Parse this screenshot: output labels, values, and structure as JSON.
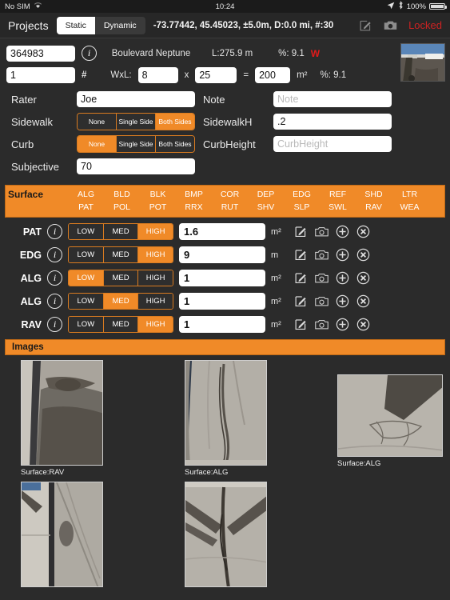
{
  "statusbar": {
    "carrier": "No SIM",
    "wifi_icon": "wifi-icon",
    "time": "10:24",
    "location_icon": "location-arrow-icon",
    "bluetooth_icon": "bluetooth-icon",
    "battery_percent": "100%",
    "battery_icon": "battery-full-icon"
  },
  "toolbar": {
    "projects_label": "Projects",
    "mode_static": "Static",
    "mode_dynamic": "Dynamic",
    "mode_selected": "Static",
    "coordinates": "-73.77442, 45.45023, ±5.0m, D:0.0 mi, #:30",
    "edit_icon": "edit-pencil-icon",
    "camera_icon": "camera-icon",
    "lock_status": "Locked",
    "lock_color": "#cc2222"
  },
  "header": {
    "segment_id": "364983",
    "info_icon": "info-circle-icon",
    "street_name": "Boulevard Neptune",
    "length_label": "L:275.9 m",
    "percent_label": "%: 9.1",
    "warning_flag": "W",
    "section_number": "1",
    "hash_symbol": "#",
    "wxl_label": "WxL:",
    "width": "8",
    "times_symbol": "x",
    "length": "25",
    "equals_symbol": "=",
    "area": "200",
    "area_unit": "m²",
    "percent_label2": "%: 9.1",
    "thumbnail_name": "road-scene-thumbnail"
  },
  "form": {
    "rater_label": "Rater",
    "rater_value": "Joe",
    "note_label": "Note",
    "note_value": "",
    "note_placeholder": "Note",
    "sidewalk_label": "Sidewalk",
    "sidewalk_options": [
      "None",
      "Single Side",
      "Both Sides"
    ],
    "sidewalk_selected": "Both Sides",
    "sidewalkh_label": "SidewalkH",
    "sidewalkh_value": ".2",
    "curb_label": "Curb",
    "curb_options": [
      "None",
      "Single Side",
      "Both Sides"
    ],
    "curb_selected": "None",
    "curbheight_label": "CurbHeight",
    "curbheight_value": "",
    "curbheight_placeholder": "CurbHeight",
    "subjective_label": "Subjective",
    "subjective_value": "70"
  },
  "surface": {
    "panel_title": "Surface",
    "accent_color": "#f08a28",
    "codes_row1": [
      "ALG",
      "BLD",
      "BLK",
      "BMP",
      "COR",
      "DEP",
      "EDG",
      "REF",
      "SHD",
      "LTR"
    ],
    "codes_row2": [
      "PAT",
      "POL",
      "POT",
      "RRX",
      "RUT",
      "SHV",
      "SLP",
      "SWL",
      "RAV",
      "WEA"
    ],
    "severity_options": [
      "LOW",
      "MED",
      "HIGH"
    ],
    "rows": [
      {
        "code": "PAT",
        "info_icon": "info-circle-icon",
        "severity": "HIGH",
        "value": "1.6",
        "unit": "m²",
        "edit_icon": "edit-pencil-icon",
        "camera_icon": "camera-icon",
        "add_icon": "plus-circle-icon",
        "delete_icon": "x-circle-icon"
      },
      {
        "code": "EDG",
        "info_icon": "info-circle-icon",
        "severity": "HIGH",
        "value": "9",
        "unit": "m",
        "edit_icon": "edit-pencil-icon",
        "camera_icon": "camera-icon",
        "add_icon": "plus-circle-icon",
        "delete_icon": "x-circle-icon"
      },
      {
        "code": "ALG",
        "info_icon": "info-circle-icon",
        "severity": "LOW",
        "value": "1",
        "unit": "m²",
        "edit_icon": "edit-pencil-icon",
        "camera_icon": "camera-icon",
        "add_icon": "plus-circle-icon",
        "delete_icon": "x-circle-icon"
      },
      {
        "code": "ALG",
        "info_icon": "info-circle-icon",
        "severity": "MED",
        "value": "1",
        "unit": "m²",
        "edit_icon": "edit-pencil-icon",
        "camera_icon": "camera-icon",
        "add_icon": "plus-circle-icon",
        "delete_icon": "x-circle-icon"
      },
      {
        "code": "RAV",
        "info_icon": "info-circle-icon",
        "severity": "HIGH",
        "value": "1",
        "unit": "m²",
        "edit_icon": "edit-pencil-icon",
        "camera_icon": "camera-icon",
        "add_icon": "plus-circle-icon",
        "delete_icon": "x-circle-icon"
      }
    ]
  },
  "images": {
    "section_title": "Images",
    "row1": [
      {
        "caption": "Surface:RAV",
        "name": "photo-surface-rav"
      },
      {
        "caption": "Surface:ALG",
        "name": "photo-surface-alg-1"
      },
      {
        "caption": "Surface:ALG",
        "name": "photo-surface-alg-2"
      }
    ],
    "row2": [
      {
        "caption": "",
        "name": "photo-surface-3"
      },
      {
        "caption": "",
        "name": "photo-surface-4"
      }
    ]
  }
}
